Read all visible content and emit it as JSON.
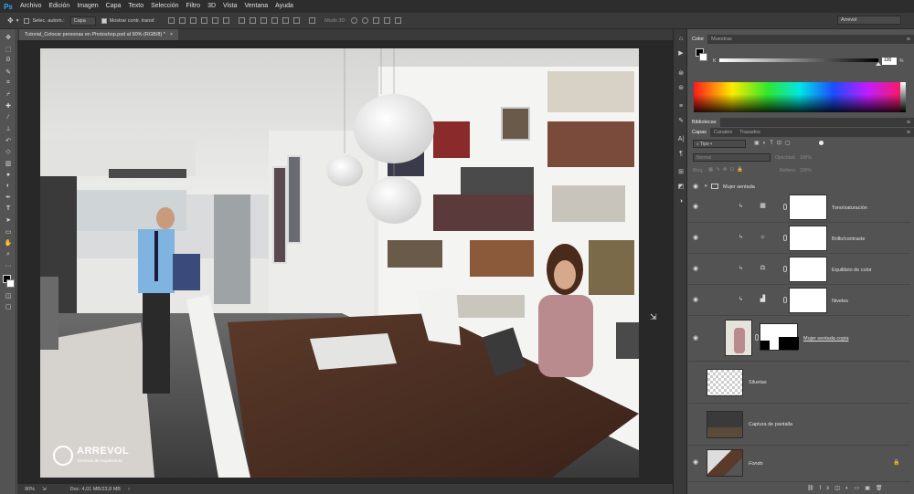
{
  "app": {
    "logo": "Ps"
  },
  "menu": [
    "Archivo",
    "Edición",
    "Imagen",
    "Capa",
    "Texto",
    "Selección",
    "Filtro",
    "3D",
    "Vista",
    "Ventana",
    "Ayuda"
  ],
  "options": {
    "auto_select_label": "Selec. autom.:",
    "auto_select_value": "Capa",
    "transform_label": "Mostrar contr. transf.",
    "mode3d_label": "Modo 3D:",
    "workspace": "Arrevol"
  },
  "document": {
    "tab_title": "Tutorial_Colocar personas en Photoshop.psd al 90% (RGB/8) *",
    "close": "×",
    "watermark_brand": "ARREVOL",
    "watermark_sub": "Servicios de Arquitectura"
  },
  "status": {
    "zoom": "90%",
    "doc": "Doc: 4,01 MB/23,8 MB",
    "arrow": "›"
  },
  "panels": {
    "color_tabs": [
      "Color",
      "Muestras"
    ],
    "k_label": "K",
    "k_value": "100",
    "k_unit": "%",
    "libraries": "Bibliotecas",
    "layers_tabs": [
      "Capas",
      "Canales",
      "Trazados"
    ],
    "kind_filter": "Tipo",
    "blend_mode": "Normal",
    "opacity_label": "Opacidad:",
    "opacity_value": "100%",
    "lock_label": "Bloq.:",
    "fill_label": "Relleno:",
    "fill_value": "100%"
  },
  "layers": [
    {
      "name": "Mujer sentada",
      "type": "group"
    },
    {
      "name": "Tono/saturación",
      "type": "adjustment",
      "icon": "hue-icon"
    },
    {
      "name": "Brillo/contraste",
      "type": "adjustment",
      "icon": "sun-icon"
    },
    {
      "name": "Equilibrio de color",
      "type": "adjustment",
      "icon": "balance-icon"
    },
    {
      "name": "Niveles",
      "type": "adjustment",
      "icon": "levels-icon"
    },
    {
      "name": "Mujer sentada copia",
      "type": "masked"
    },
    {
      "name": "Siluetas",
      "type": "pixel"
    },
    {
      "name": "Captura de pantalla",
      "type": "pixel"
    },
    {
      "name": "Fondo",
      "type": "background"
    }
  ]
}
